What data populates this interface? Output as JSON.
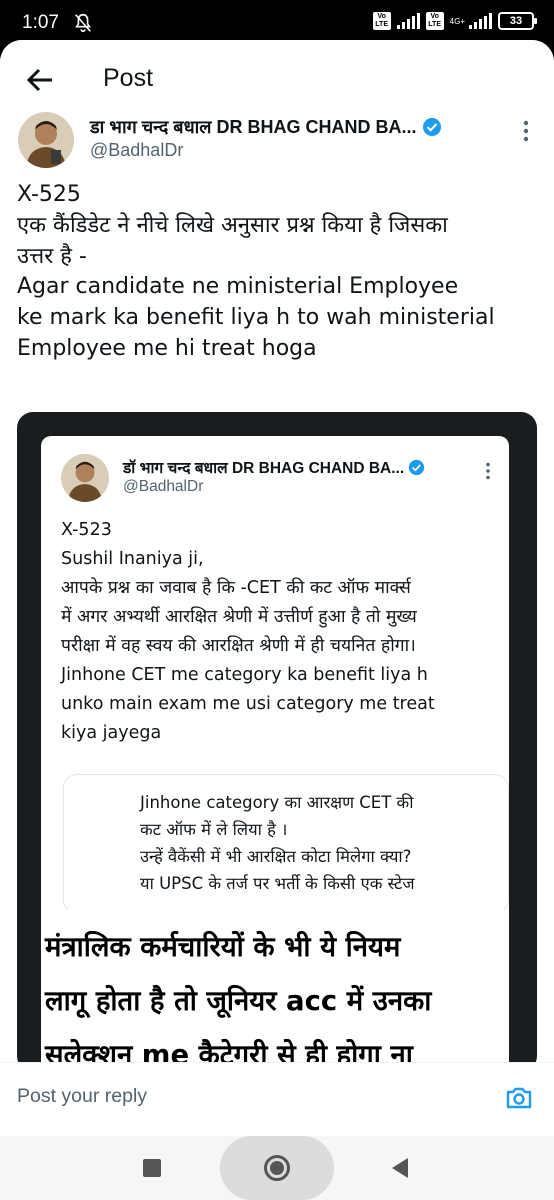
{
  "status_bar": {
    "time": "1:07",
    "mute_icon": "bell-off-icon",
    "sim1_label": "Vo\nLTE",
    "sim2_label": "Vo\nLTE",
    "network_label": "4G+",
    "battery": "33"
  },
  "header": {
    "title": "Post",
    "back_icon": "arrow-left-icon"
  },
  "post": {
    "author_name": "डा भाग चन्द बधाल DR BHAG CHAND BA...",
    "handle": "@BadhalDr",
    "verified": true,
    "more_icon": "more-vertical-icon",
    "text_lines": [
      "X-525",
      "एक कैंडिडेट ने नीचे लिखे अनुसार प्रश्न किया है जिसका",
      "उत्तर है -",
      "Agar candidate ne ministerial Employee",
      "ke mark ka benefit liya h to wah ministerial",
      "Employee me hi treat hoga"
    ]
  },
  "embedded": {
    "author_name": "डॉ भाग चन्द बधाल DR BHAG CHAND BA...",
    "handle": "@BadhalDr",
    "text_lines": [
      "X-523",
      "Sushil Inaniya ji,",
      "आपके प्रश्न का जवाब है कि -CET की कट ऑफ मार्क्स",
      "में अगर अभ्यर्थी आरक्षित श्रेणी में उत्तीर्ण हुआ है तो मुख्य",
      "परीक्षा में वह स्वय की आरक्षित श्रेणी में ही चयनित होगा।",
      " Jinhone CET me category ka benefit liya h",
      "unko main exam me usi category me treat",
      "kiya jayega"
    ],
    "quote_lines": [
      "Jinhone category का आरक्षण CET की",
      "कट ऑफ में ले लिया है ।",
      "उन्हें वैकेंसी में भी आरक्षित कोटा मिलेगा क्या?",
      "या UPSC के तर्ज पर भर्ती के किसी एक स्टेज"
    ],
    "caption_lines": [
      "मंत्रालिक कर्मचारियों के भी ये नियम",
      "लागू होता है तो जूनियर acc में उनका",
      "सलेक्शन me कैटेगरी से ही होगा ना"
    ]
  },
  "reply": {
    "placeholder": "Post your reply",
    "camera_icon": "camera-icon"
  },
  "colors": {
    "accent": "#1d9bf0",
    "text": "#0f1419",
    "muted": "#536471"
  }
}
